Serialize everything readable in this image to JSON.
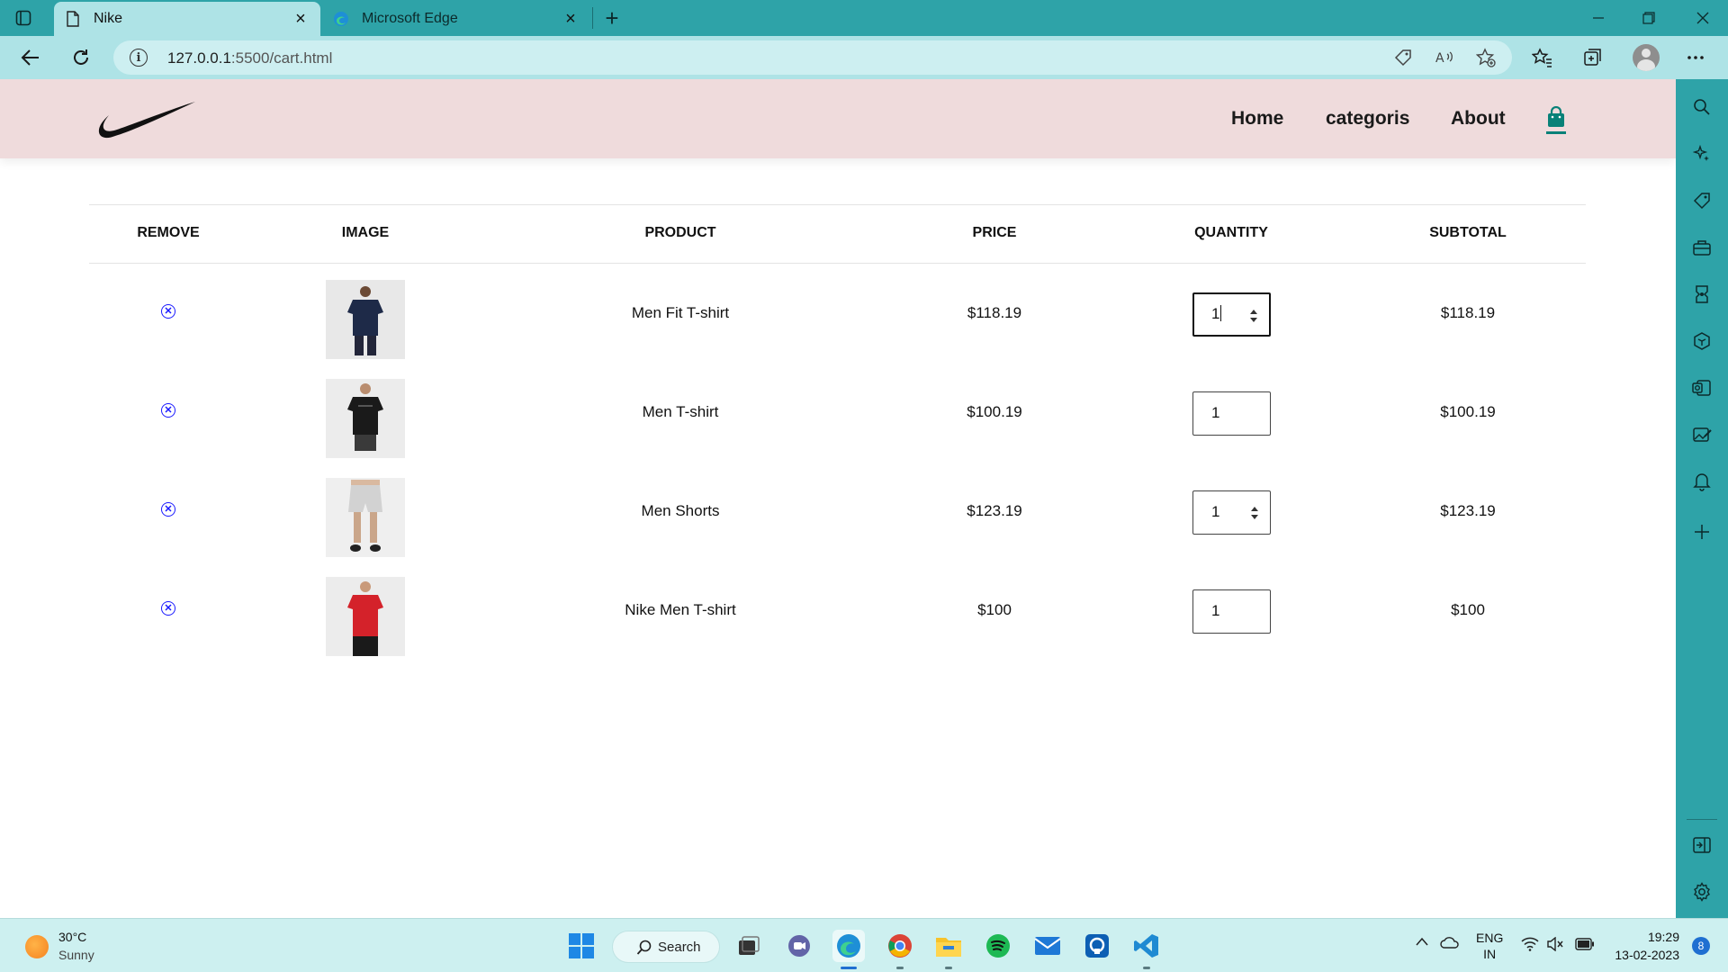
{
  "browser": {
    "tabs": [
      {
        "title": "Nike",
        "icon": "page-icon",
        "active": true
      },
      {
        "title": "Microsoft Edge",
        "icon": "edge-icon",
        "active": false
      }
    ],
    "address": {
      "host": "127.0.0.1",
      "path": ":5500/cart.html"
    },
    "accent_color": "#2ea3a8"
  },
  "site": {
    "header_bg": "#efdbdc",
    "nav": [
      {
        "label": "Home"
      },
      {
        "label": "categoris"
      },
      {
        "label": "About"
      }
    ],
    "cart_icon": "shopping-bag-icon",
    "brand_color": "#088178"
  },
  "cart": {
    "columns": [
      "REMOVE",
      "IMAGE",
      "PRODUCT",
      "PRICE",
      "QUANTITY",
      "SUBTOTAL"
    ],
    "rows": [
      {
        "product": "Men Fit T-shirt",
        "price": "$118.19",
        "quantity": "1",
        "subtotal": "$118.19",
        "image": "navy-tshirt-model"
      },
      {
        "product": "Men T-shirt",
        "price": "$100.19",
        "quantity": "1",
        "subtotal": "$100.19",
        "image": "black-tshirt-model"
      },
      {
        "product": "Men Shorts",
        "price": "$123.19",
        "quantity": "1",
        "subtotal": "$123.19",
        "image": "grey-shorts-model"
      },
      {
        "product": "Nike Men T-shirt",
        "price": "$100",
        "quantity": "1",
        "subtotal": "$100",
        "image": "red-tshirt-model"
      }
    ]
  },
  "taskbar": {
    "weather": {
      "temp": "30°C",
      "desc": "Sunny"
    },
    "search_label": "Search",
    "language": {
      "lang": "ENG",
      "region": "IN"
    },
    "clock": {
      "time": "19:29",
      "date": "13-02-2023"
    },
    "notifications": "8"
  }
}
